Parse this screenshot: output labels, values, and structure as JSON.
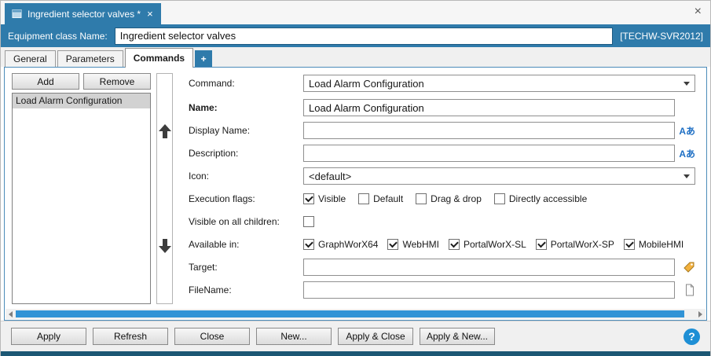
{
  "doc_tab": {
    "title": "Ingredient selector valves *",
    "close_glyph": "×"
  },
  "window_close_glyph": "×",
  "header": {
    "label": "Equipment class Name:",
    "value": "Ingredient selector valves",
    "server": "[TECHW-SVR2012]"
  },
  "tabs": [
    {
      "label": "General"
    },
    {
      "label": "Parameters"
    },
    {
      "label": "Commands"
    },
    {
      "label": "+"
    }
  ],
  "left_panel": {
    "add_label": "Add",
    "remove_label": "Remove",
    "items": [
      "Load Alarm Configuration"
    ]
  },
  "form": {
    "command": {
      "label": "Command:",
      "value": "Load Alarm Configuration"
    },
    "name": {
      "label": "Name:",
      "value": "Load Alarm Configuration"
    },
    "display_name": {
      "label": "Display Name:",
      "value": "",
      "icon_glyph": "Aあ"
    },
    "description": {
      "label": "Description:",
      "value": "",
      "icon_glyph": "Aあ"
    },
    "icon": {
      "label": "Icon:",
      "value": "<default>"
    },
    "execution_flags": {
      "label": "Execution flags:",
      "options": [
        {
          "label": "Visible",
          "checked": true
        },
        {
          "label": "Default",
          "checked": false
        },
        {
          "label": "Drag & drop",
          "checked": false
        },
        {
          "label": "Directly accessible",
          "checked": false
        }
      ]
    },
    "visible_on_all_children": {
      "label": "Visible on all children:",
      "checked": false
    },
    "available_in": {
      "label": "Available in:",
      "options": [
        {
          "label": "GraphWorX64",
          "checked": true
        },
        {
          "label": "WebHMI",
          "checked": true
        },
        {
          "label": "PortalWorX-SL",
          "checked": true
        },
        {
          "label": "PortalWorX-SP",
          "checked": true
        },
        {
          "label": "MobileHMI",
          "checked": true
        }
      ]
    },
    "target": {
      "label": "Target:",
      "value": ""
    },
    "filename": {
      "label": "FileName:",
      "value": ""
    }
  },
  "footer": {
    "buttons": [
      "Apply",
      "Refresh",
      "Close",
      "New...",
      "Apply & Close",
      "Apply & New..."
    ],
    "help_glyph": "?"
  },
  "colors": {
    "accent_blue": "#2f7bab",
    "accent_teal": "#1c5774",
    "scrollbar_thumb": "#3093d6",
    "help_blue": "#1e8fd5"
  }
}
